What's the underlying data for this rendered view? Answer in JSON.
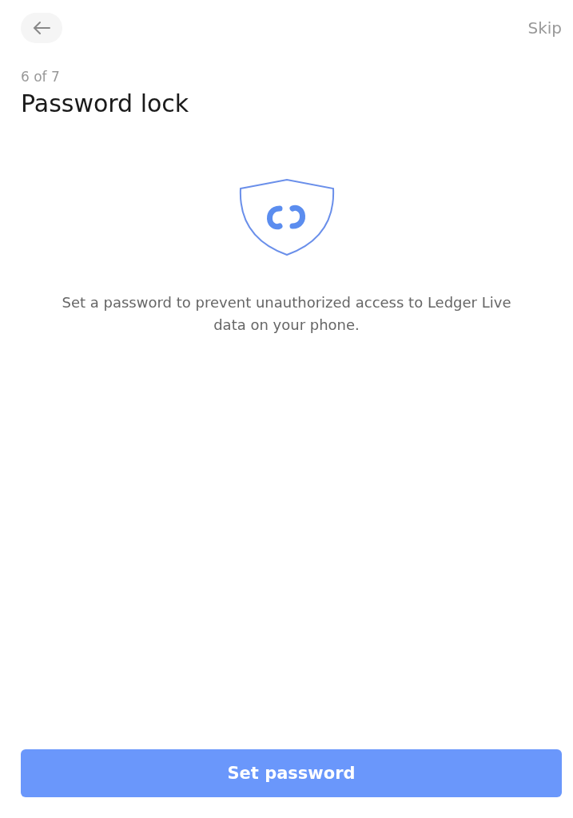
{
  "header": {
    "skip": "Skip"
  },
  "step": "6 of 7",
  "title": "Password lock",
  "description": "Set a password to prevent unauthorized access to Ledger Live data on your phone.",
  "button": "Set password"
}
